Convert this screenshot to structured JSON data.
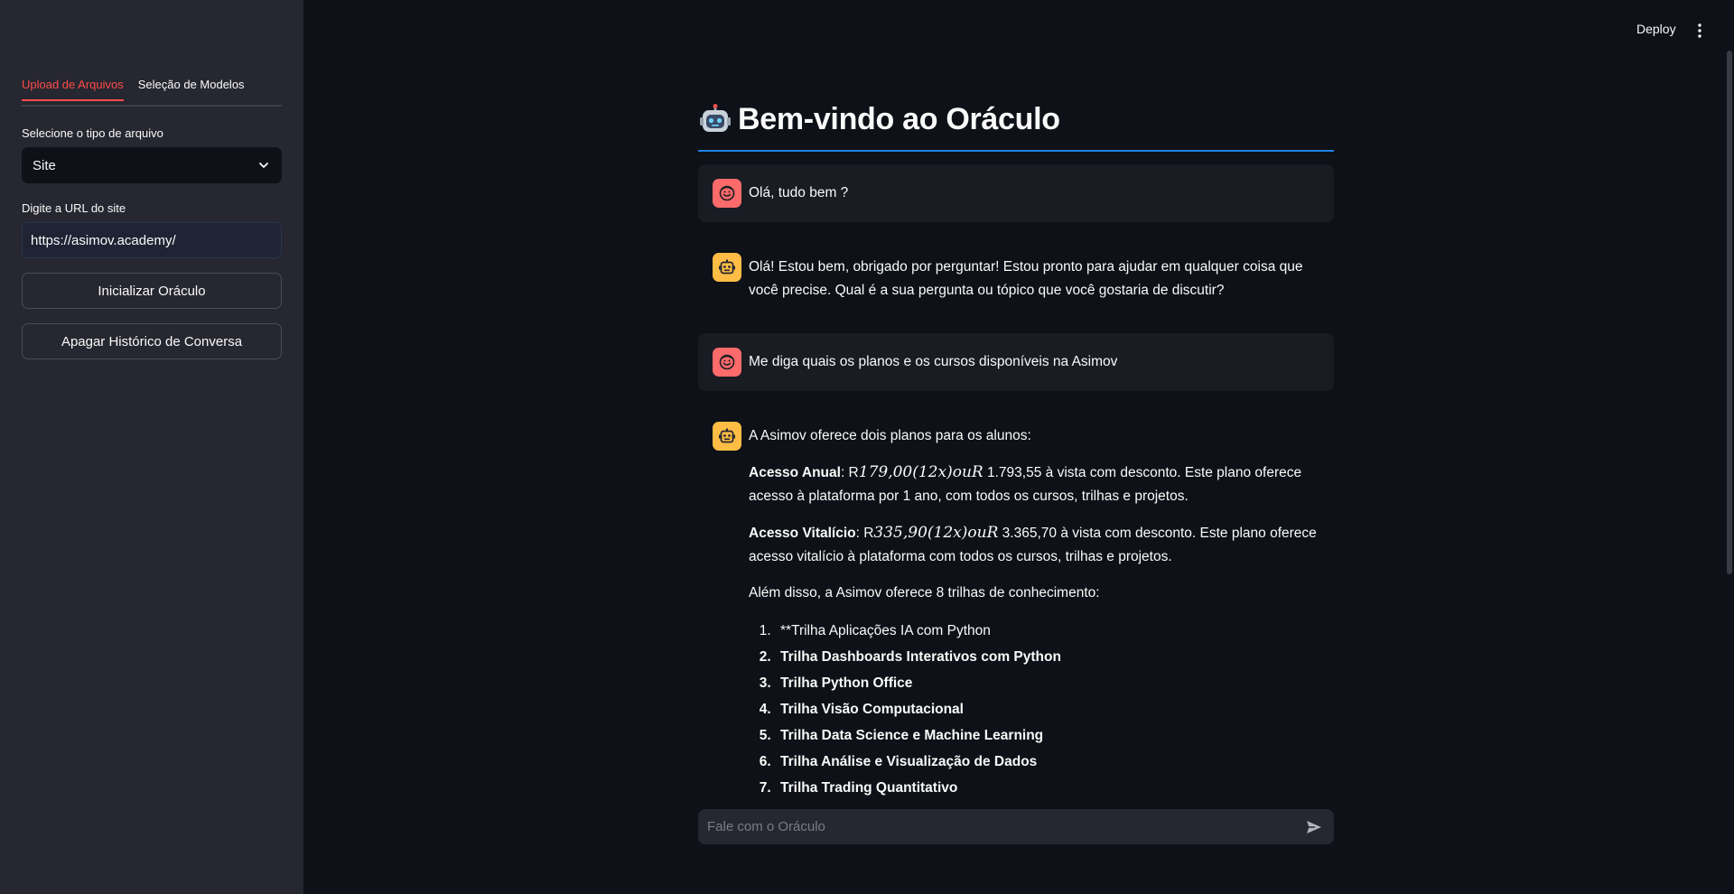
{
  "header": {
    "deploy_label": "Deploy",
    "menu_icon": "kebab-menu-icon"
  },
  "sidebar": {
    "tabs": [
      {
        "label": "Upload de Arquivos",
        "active": true
      },
      {
        "label": "Seleção de Modelos",
        "active": false
      }
    ],
    "file_type": {
      "label": "Selecione o tipo de arquivo",
      "value": "Site"
    },
    "url": {
      "label": "Digite a URL do site",
      "value": "https://asimov.academy/"
    },
    "buttons": {
      "init": "Inicializar Oráculo",
      "clear": "Apagar Histórico de Conversa"
    }
  },
  "main": {
    "title": "Bem-vindo ao Oráculo",
    "title_icon": "robot-emoji-icon",
    "accent_color": "#ff4b4b",
    "messages": [
      {
        "role": "user",
        "text": "Olá, tudo bem ?"
      },
      {
        "role": "assistant",
        "text": "Olá! Estou bem, obrigado por perguntar! Estou pronto para ajudar em qualquer coisa que você precise. Qual é a sua pergunta ou tópico que você gostaria de discutir?"
      },
      {
        "role": "user",
        "text": "Me diga quais os planos e os cursos disponíveis na Asimov"
      },
      {
        "role": "assistant",
        "intro": "A Asimov oferece dois planos para os alunos:",
        "plans": [
          {
            "name": "Acesso Anual",
            "prefix": ": R",
            "math": "179,00(12x)ouR",
            "rest": " 1.793,55 à vista com desconto. Este plano oferece acesso à plataforma por 1 ano, com todos os cursos, trilhas e projetos."
          },
          {
            "name": "Acesso Vitalício",
            "prefix": ": R",
            "math": "335,90(12x)ouR",
            "rest": " 3.365,70 à vista com desconto. Este plano oferece acesso vitalício à plataforma com todos os cursos, trilhas e projetos."
          }
        ],
        "tracks_intro": "Além disso, a Asimov oferece 8 trilhas de conhecimento:",
        "tracks": [
          {
            "text": "**Trilha Aplicações IA com Python",
            "bold": false
          },
          {
            "text": "Trilha Dashboards Interativos com Python",
            "bold": true
          },
          {
            "text": "Trilha Python Office",
            "bold": true
          },
          {
            "text": "Trilha Visão Computacional",
            "bold": true
          },
          {
            "text": "Trilha Data Science e Machine Learning",
            "bold": true
          },
          {
            "text": "Trilha Análise e Visualização de Dados",
            "bold": true
          },
          {
            "text": "Trilha Trading Quantitativo",
            "bold": true
          }
        ]
      }
    ]
  },
  "chat_input": {
    "placeholder": "Fale com o Oráculo"
  }
}
